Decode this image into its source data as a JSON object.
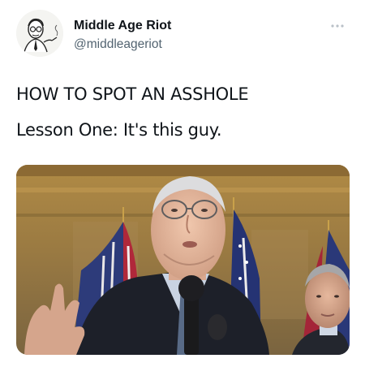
{
  "tweet": {
    "author": {
      "display_name": "Middle Age Riot",
      "handle": "@middleageriot",
      "avatar_icon": "caricature-avatar-icon"
    },
    "more_icon": "more-options-icon",
    "text_lines": [
      "HOW TO SPOT AN ASSHOLE",
      "Lesson One: It's this guy."
    ],
    "media": {
      "type": "photo",
      "icon": "photo-image"
    }
  },
  "colors": {
    "text_primary": "#0f1419",
    "text_secondary": "#536471",
    "background": "#ffffff"
  }
}
